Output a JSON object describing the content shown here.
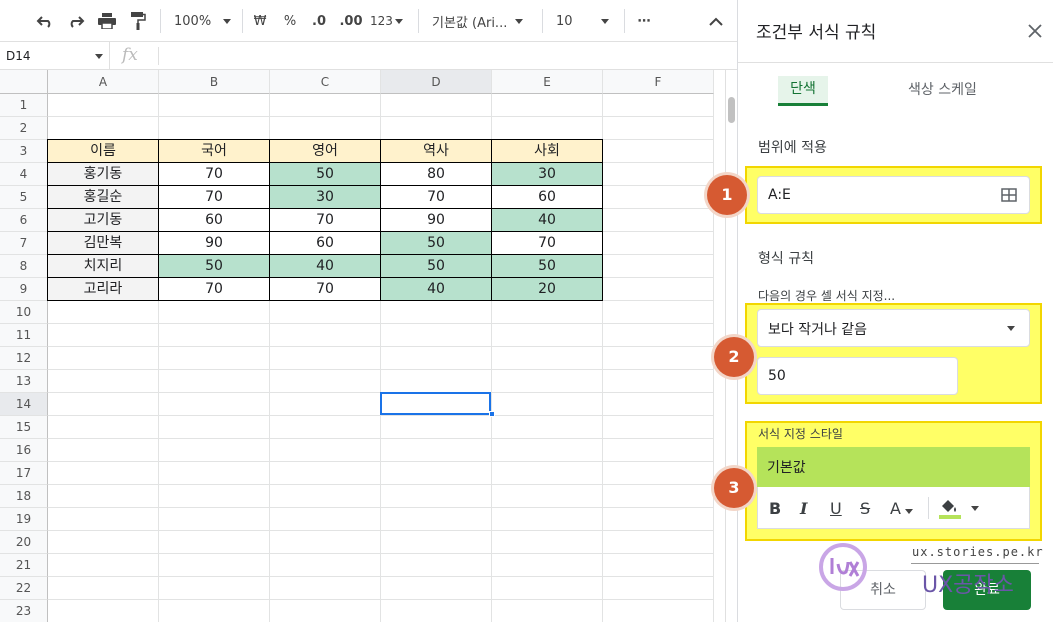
{
  "toolbar": {
    "zoom": "100%",
    "currency": "₩",
    "percent": "%",
    "decrease_decimal": ".0",
    "increase_decimal": ".00",
    "number_format": "123",
    "font": "기본값 (Ari...",
    "font_size": "10",
    "more": "⋯"
  },
  "formula_bar": {
    "cell_ref": "D14",
    "fx": "fx"
  },
  "columns": [
    "A",
    "B",
    "C",
    "D",
    "E",
    "F"
  ],
  "rows": [
    "1",
    "2",
    "3",
    "4",
    "5",
    "6",
    "7",
    "8",
    "9",
    "10",
    "11",
    "12",
    "13",
    "14",
    "15",
    "16",
    "17",
    "18",
    "19",
    "20",
    "21",
    "22",
    "23"
  ],
  "table": {
    "headers": [
      "이름",
      "국어",
      "영어",
      "역사",
      "사회"
    ],
    "rows": [
      [
        "홍기동",
        "70",
        "50",
        "80",
        "30"
      ],
      [
        "홍길순",
        "70",
        "30",
        "70",
        "60"
      ],
      [
        "고기동",
        "60",
        "70",
        "90",
        "40"
      ],
      [
        "김만복",
        "90",
        "60",
        "50",
        "70"
      ],
      [
        "치지리",
        "50",
        "40",
        "50",
        "50"
      ],
      [
        "고리라",
        "70",
        "70",
        "40",
        "20"
      ]
    ],
    "highlight": [
      [
        false,
        false,
        true,
        false,
        true
      ],
      [
        false,
        false,
        true,
        false,
        false
      ],
      [
        false,
        false,
        false,
        false,
        true
      ],
      [
        false,
        false,
        false,
        true,
        false
      ],
      [
        false,
        true,
        true,
        true,
        true
      ],
      [
        false,
        false,
        false,
        true,
        true
      ]
    ]
  },
  "colors": {
    "header_fill": "#fff2cc",
    "highlight_fill": "#b7e1cd",
    "preview_fill": "#b5e35a",
    "accent": "#188038",
    "badge": "#d65a32"
  },
  "panel": {
    "title": "조건부 서식 규칙",
    "tabs": [
      "단색",
      "색상 스케일"
    ],
    "range_label": "범위에 적용",
    "range_value": "A:E",
    "rules_label": "형식 규칙",
    "condition_label": "다음의 경우 셀 서식 지정...",
    "condition_value": "보다 작거나 같음",
    "condition_input": "50",
    "style_label": "서식 지정 스타일",
    "style_preview": "기본값",
    "format_buttons": [
      "B",
      "I",
      "U",
      "S",
      "A"
    ],
    "cancel": "취소",
    "done": "완료"
  },
  "badges": [
    "1",
    "2",
    "3"
  ],
  "watermark": {
    "url": "ux.stories.pe.kr",
    "name": "UX공작소"
  }
}
